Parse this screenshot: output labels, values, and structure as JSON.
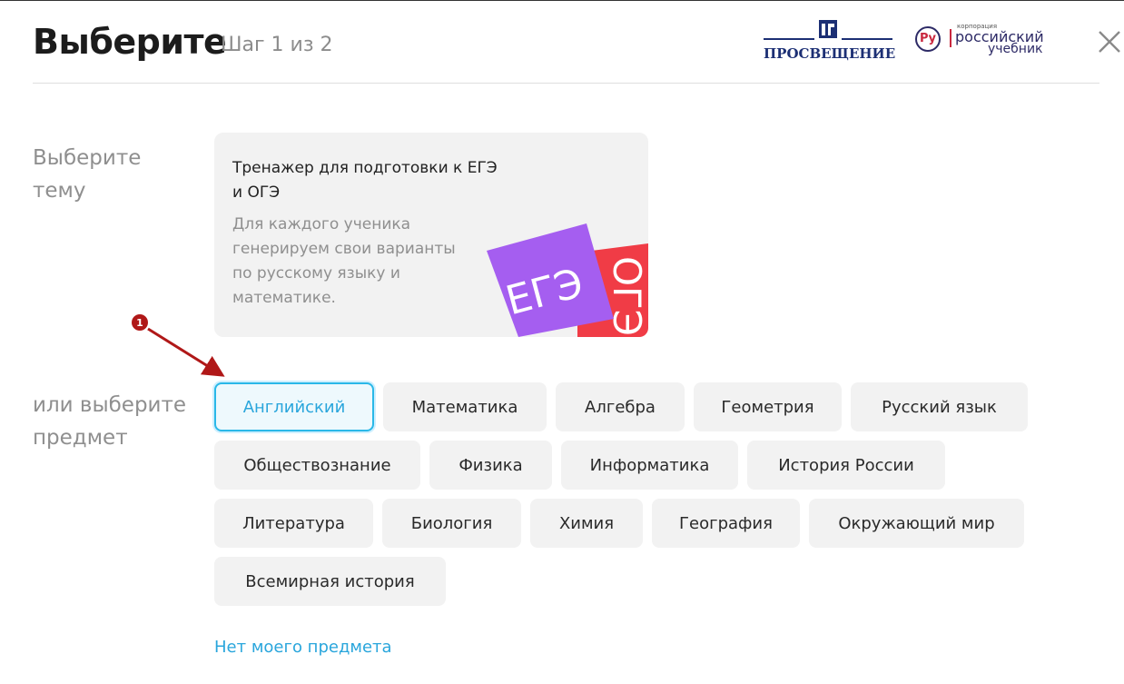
{
  "header": {
    "title": "Выберите",
    "step": "Шаг 1 из 2",
    "logo_prosv": "ПРОСВЕЩЕНИЕ",
    "logo_ru_small": "корпорация",
    "logo_ru_line1": "российский",
    "logo_ru_line2": "учебник",
    "logo_ru_mark": "Ру",
    "close_icon": "close-icon"
  },
  "topic": {
    "label": "Выберите тему",
    "card": {
      "title": "Тренажер для подготовки к ЕГЭ и ОГЭ",
      "description": "Для каждого ученика генерируем свои варианты по русскому языку и математике.",
      "art_text_1": "ЕГЭ",
      "art_text_2": "ОГЭ",
      "art_color_1": "#a55ef0",
      "art_color_2": "#f03c46"
    }
  },
  "subjects": {
    "label": "или выберите предмет",
    "rows": [
      [
        "Английский",
        "Математика",
        "Алгебра",
        "Геометрия",
        "Русский язык"
      ],
      [
        "Обществознание",
        "Физика",
        "Информатика",
        "История России"
      ],
      [
        "Литература",
        "Биология",
        "Химия",
        "География",
        "Окружающий мир"
      ],
      [
        "Всемирная история"
      ]
    ],
    "selected": "Английский",
    "no_subject_link": "Нет моего предмета"
  },
  "annotation": {
    "badge": "1",
    "color": "#b01818"
  },
  "colors": {
    "accent": "#2aa6dc",
    "chip_bg": "#f2f2f2",
    "muted_text": "#8f8f8f"
  }
}
